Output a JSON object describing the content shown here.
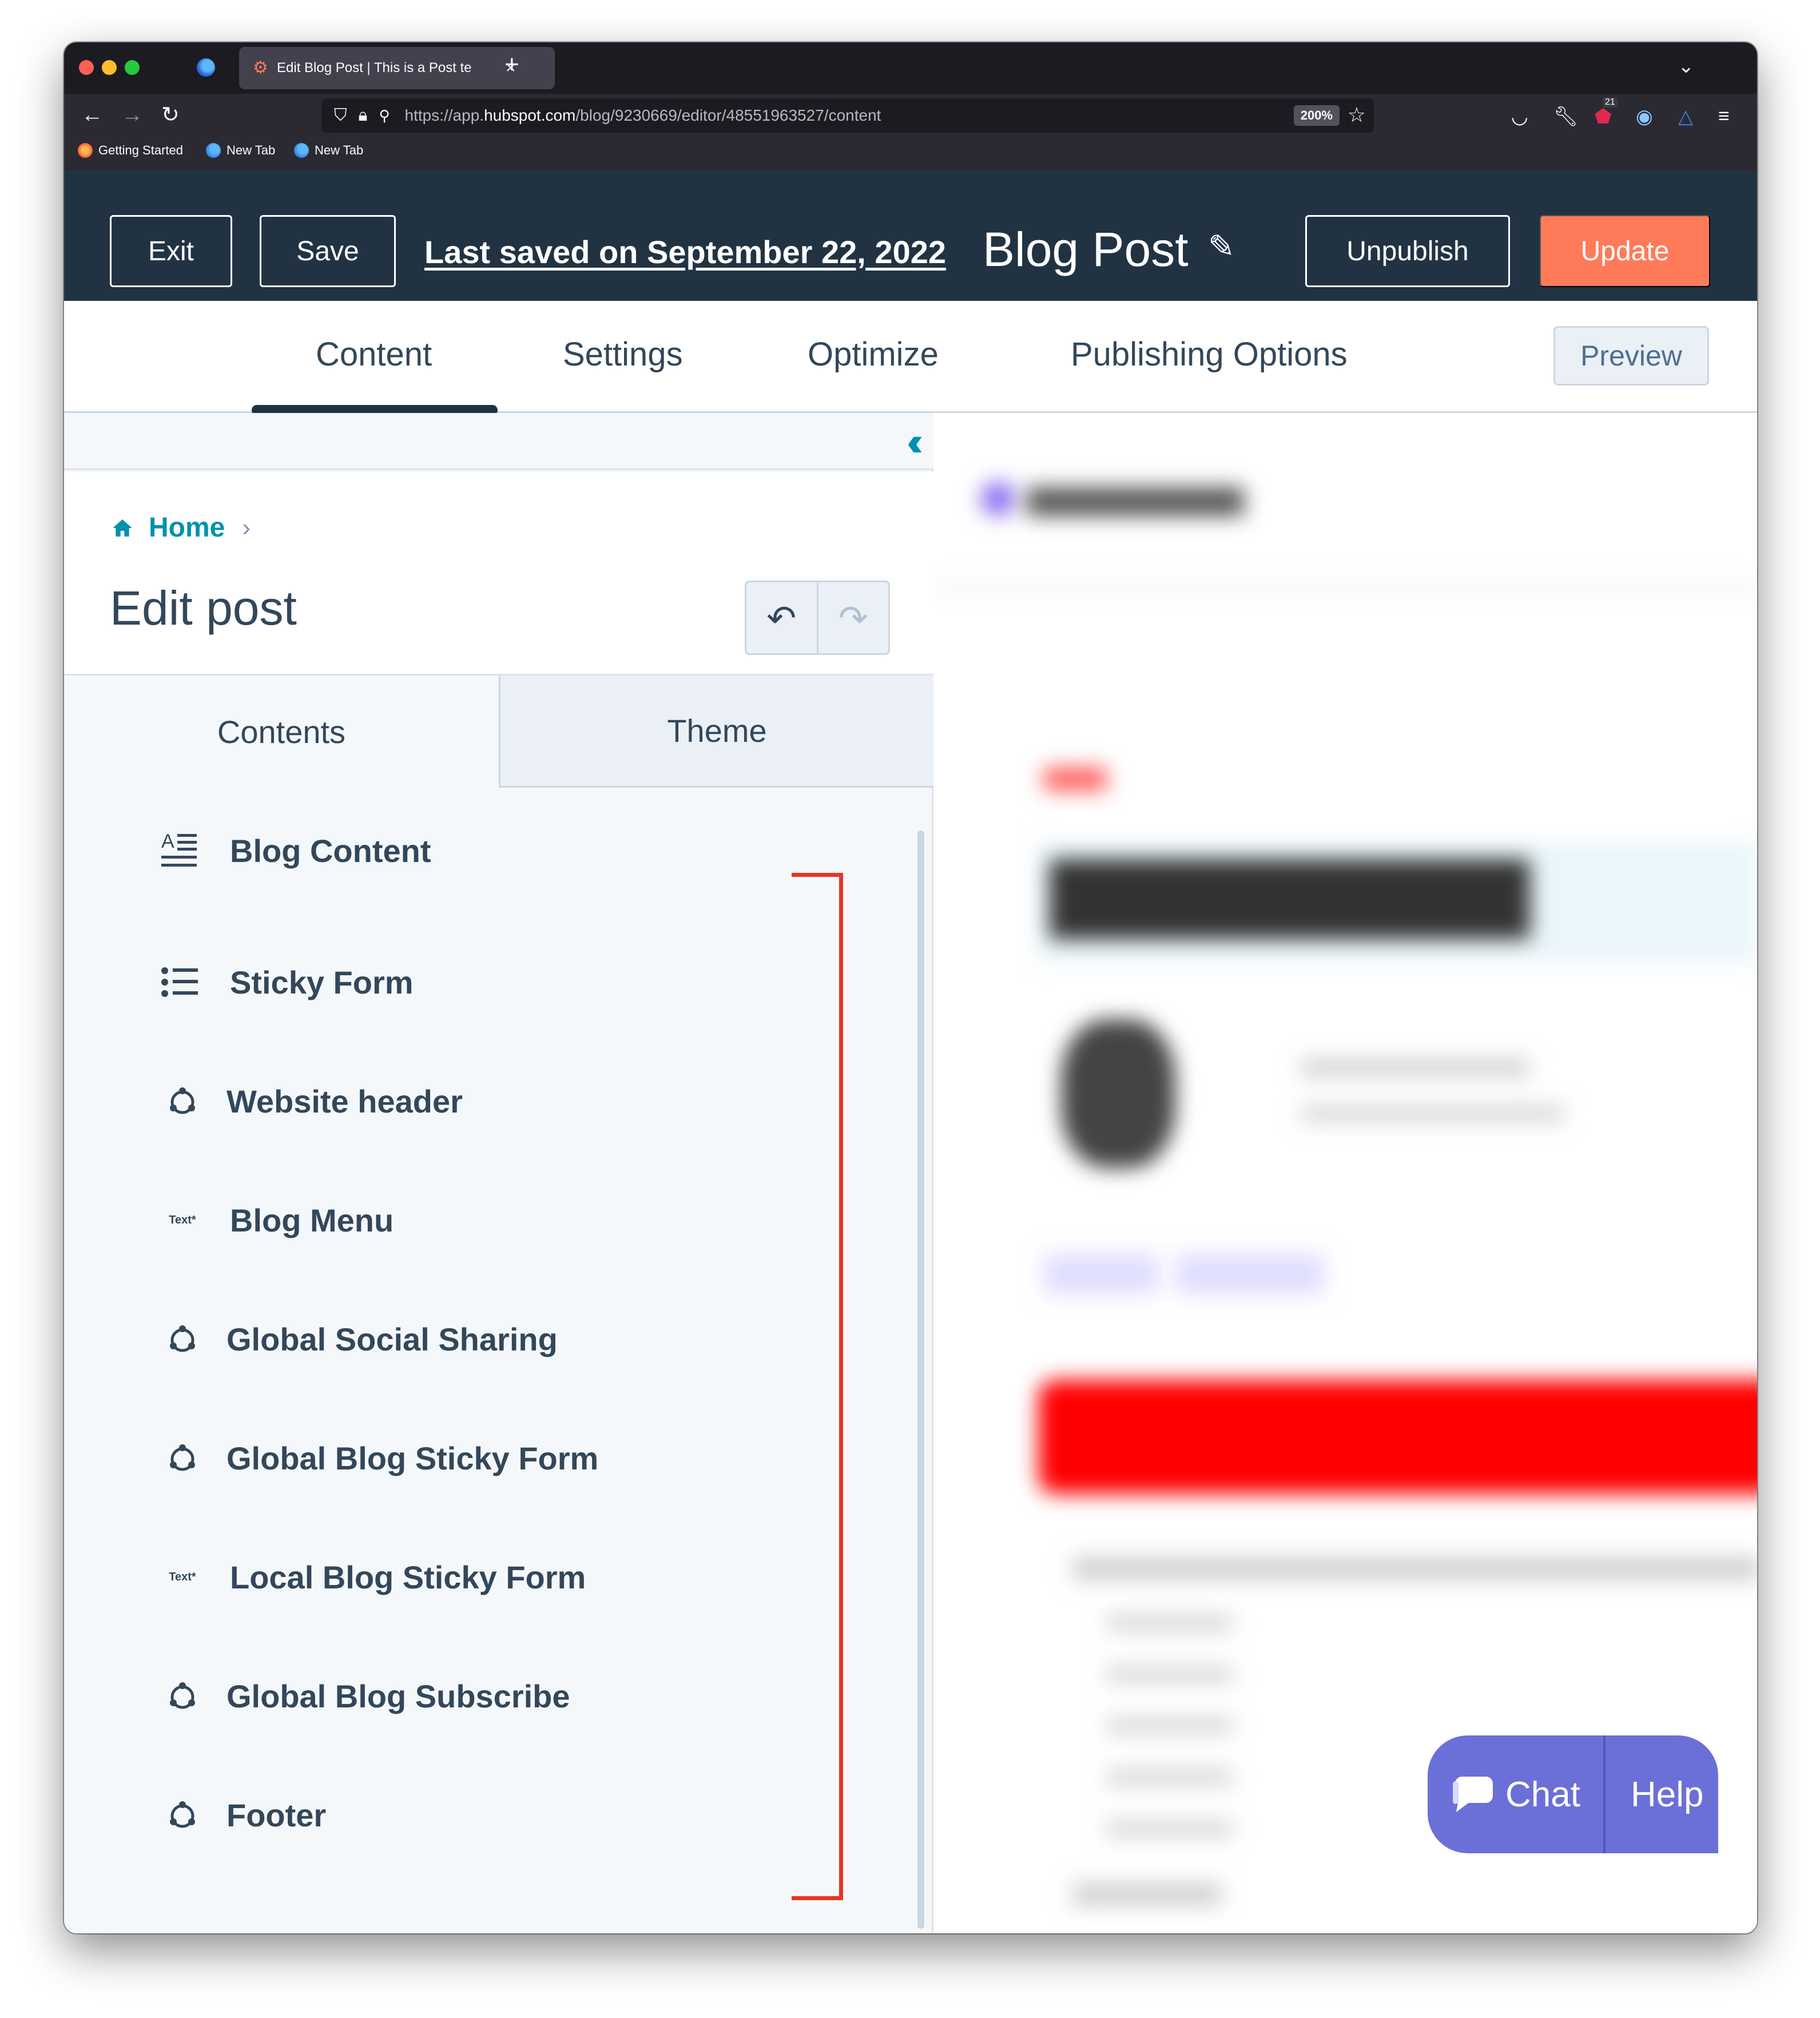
{
  "browser": {
    "tab_title": "Edit Blog Post | This is a Post te",
    "url_prefix": "https://app.",
    "url_domain": "hubspot.com",
    "url_path": "/blog/9230669/editor/48551963527/content",
    "zoom": "200%",
    "notification_count": "21",
    "bookmarks": [
      "Getting Started",
      "New Tab",
      "New Tab"
    ]
  },
  "header": {
    "exit_label": "Exit",
    "save_label": "Save",
    "last_saved": "Last saved on September 22, 2022",
    "post_title": "Blog Post",
    "unpublish_label": "Unpublish",
    "update_label": "Update",
    "accent_color": "#ff7a59"
  },
  "main_tabs": {
    "items": [
      "Content",
      "Settings",
      "Optimize",
      "Publishing Options"
    ],
    "active": "Content",
    "preview_label": "Preview"
  },
  "sidebar": {
    "breadcrumb_home": "Home",
    "title": "Edit post",
    "tabs": [
      "Contents",
      "Theme"
    ],
    "modules": [
      {
        "label": "Blog Content",
        "icon": "rich-text-icon"
      },
      {
        "label": "Sticky Form",
        "icon": "form-list-icon"
      },
      {
        "label": "Website header",
        "icon": "global-module-icon"
      },
      {
        "label": "Blog Menu",
        "icon": "text-icon",
        "icon_text": "Text*"
      },
      {
        "label": "Global Social Sharing",
        "icon": "global-module-icon"
      },
      {
        "label": "Global Blog Sticky Form",
        "icon": "global-module-icon"
      },
      {
        "label": "Local Blog Sticky Form",
        "icon": "text-icon",
        "icon_text": "Text*"
      },
      {
        "label": "Global Blog Subscribe",
        "icon": "global-module-icon"
      },
      {
        "label": "Footer",
        "icon": "global-module-icon"
      }
    ]
  },
  "chat": {
    "chat_label": "Chat",
    "help_label": "Help",
    "color": "#6b6fd8"
  }
}
